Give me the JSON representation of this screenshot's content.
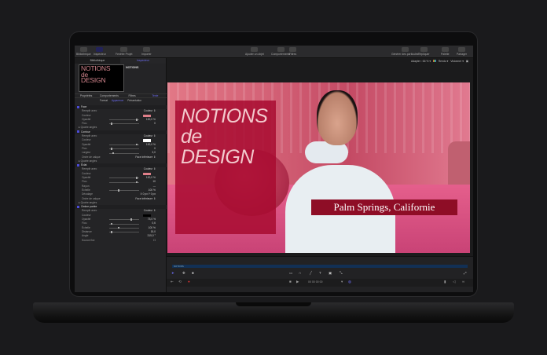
{
  "toolbar": {
    "left": [
      {
        "label": "Bibliothèque",
        "icon": "library-icon"
      },
      {
        "label": "Inspecteur",
        "icon": "inspector-icon",
        "active": true
      },
      {
        "label": "Fenêtre Projet",
        "icon": "project-window-icon"
      },
      {
        "label": "Importer",
        "icon": "import-icon"
      }
    ],
    "center": [
      {
        "label": "Ajouter un objet",
        "icon": "add-object-icon"
      },
      {
        "label": "Comportements",
        "icon": "behaviors-icon"
      },
      {
        "label": "Filtres",
        "icon": "filters-icon"
      }
    ],
    "right": [
      {
        "label": "Générer des particules",
        "icon": "particles-icon"
      },
      {
        "label": "Répliquer",
        "icon": "replicate-icon"
      },
      {
        "label": "Palette",
        "icon": "palette-icon"
      },
      {
        "label": "Partager",
        "icon": "share-icon"
      }
    ]
  },
  "left_tabs": [
    "Bibliothèque",
    "Inspecteur"
  ],
  "preview": {
    "thumb_text": "NOTIONS\nde\nDESIGN",
    "name": "NOTIONS"
  },
  "inspector_tabs": [
    "Propriétés",
    "Comportements",
    "Filtres",
    "Texte"
  ],
  "sub_tabs": [
    "Format",
    "Apparence",
    "Présentation"
  ],
  "rows": [
    {
      "t": "sec",
      "label": "Face"
    },
    {
      "label": "Remplir avec",
      "value": "Couleur ⇕"
    },
    {
      "label": "Couleur",
      "swatch": "#e0808a"
    },
    {
      "label": "Opacité",
      "value": "100,0 %",
      "slider": 0.95
    },
    {
      "label": "Flou",
      "value": "0",
      "slider": 0.05
    },
    {
      "t": "ex",
      "label": "Quatre angles"
    },
    {
      "t": "sec",
      "label": "Contour"
    },
    {
      "label": "Remplir avec",
      "value": "Couleur ⇕"
    },
    {
      "label": "Couleur",
      "swatch": "#ffffff"
    },
    {
      "label": "Opacité",
      "value": "100,0 %",
      "slider": 0.95
    },
    {
      "label": "Flou",
      "value": "0",
      "slider": 0.05
    },
    {
      "label": "Largeur",
      "value": "3,0",
      "slider": 0.1
    },
    {
      "label": "Ordre de calque",
      "value": "Face inférieure ⇕"
    },
    {
      "t": "ex",
      "label": "Quatre angles"
    },
    {
      "t": "sec",
      "label": "Éclat"
    },
    {
      "label": "Remplir avec",
      "value": "Couleur ⇕"
    },
    {
      "label": "Couleur",
      "swatch": "#e0808a"
    },
    {
      "label": "Opacité",
      "value": "100,0 %",
      "slider": 0.95
    },
    {
      "label": "Flou",
      "value": "10",
      "slider": 0.95
    },
    {
      "label": "Rayon",
      "value": "—"
    },
    {
      "label": "Échelle",
      "value": "100 %",
      "slider": 0.3
    },
    {
      "label": "Décalage",
      "value": "X 0 px   Y 0 px"
    },
    {
      "label": "Ordre de calque",
      "value": "Face inférieure ⇕"
    },
    {
      "t": "ex",
      "label": "Quatre angles"
    },
    {
      "t": "sec",
      "label": "Ombre portée"
    },
    {
      "label": "Remplir avec",
      "value": "Couleur ⇕"
    },
    {
      "label": "Couleur",
      "swatch": "#000000"
    },
    {
      "label": "Opacité",
      "value": "75,0 %",
      "slider": 0.75
    },
    {
      "label": "Flou",
      "value": "0,6",
      "slider": 0.05
    },
    {
      "label": "Échelle",
      "value": "100 %",
      "slider": 0.3
    },
    {
      "label": "Distance",
      "value": "15,0",
      "slider": 0.05
    },
    {
      "label": "Angle",
      "value": "315,0 °"
    },
    {
      "label": "Source fixe",
      "value": "☐"
    }
  ],
  "viewer": {
    "fit": "Adapter : 66 %",
    "render": "Rendu",
    "display": "Visionner"
  },
  "canvas": {
    "title": "NOTIONS\nde\nDESIGN",
    "place": "Palm Springs, Californie"
  },
  "timeline": {
    "track": "NOTIONS",
    "timecode": "00 00 00 00"
  },
  "colors": {
    "accent": "#5b5bf0",
    "title_box": "#a80a30",
    "place_box": "#8e0d26"
  }
}
